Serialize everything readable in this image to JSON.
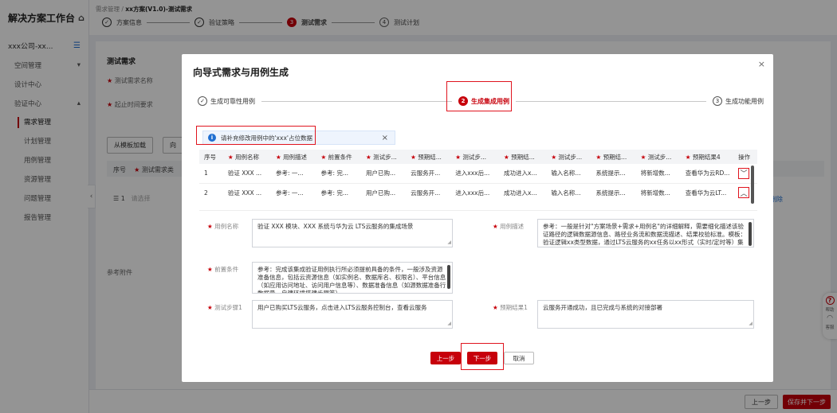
{
  "app": {
    "title": "解决方案工作台"
  },
  "sidebar": {
    "tenant": "xxx公司-xx...",
    "items": [
      {
        "label": "空间管理",
        "arrow": "▾"
      },
      {
        "label": "设计中心",
        "arrow": ""
      },
      {
        "label": "验证中心",
        "arrow": "▴"
      }
    ],
    "sub_items": [
      "需求管理",
      "计划管理",
      "用例管理",
      "资源管理",
      "问题管理",
      "报告管理"
    ]
  },
  "breadcrumb": {
    "parent": "需求管理 / ",
    "current": "xx方案(V1.0)-测试需求"
  },
  "page_steps": [
    {
      "label": "方案信息",
      "icon": "✓",
      "state": "done"
    },
    {
      "label": "验证策略",
      "icon": "✓",
      "state": "done"
    },
    {
      "label": "测试需求",
      "icon": "3",
      "state": "current"
    },
    {
      "label": "测试计划",
      "icon": "4",
      "state": "todo"
    }
  ],
  "background": {
    "section_title": "测试需求",
    "label_name": "测试需求名称",
    "label_time": "起止时间要求",
    "btn_template": "从模板加载",
    "btn_partial": "向",
    "col_no": "序号",
    "col_name": "测试需求类",
    "row_no": "1",
    "row_select": "请选择",
    "attach_label": "参考附件",
    "delete_link": "删除"
  },
  "footer": {
    "prev": "上一步",
    "save_next": "保存并下一步"
  },
  "float_help": {
    "help": "帮助",
    "service": "客服"
  },
  "modal": {
    "title": "向导式需求与用例生成",
    "close": "×",
    "wizard": [
      {
        "label": "生成可靠性用例",
        "icon": "✓",
        "state": "done"
      },
      {
        "label": "生成集成用例",
        "icon": "2",
        "state": "current"
      },
      {
        "label": "生成功能用例",
        "icon": "3",
        "state": "todo"
      }
    ],
    "alert": {
      "text": "请补充修改用例中的'xxx'占位数据",
      "close": "×"
    },
    "table": {
      "headers": [
        "序号",
        "用例名称",
        "用例描述",
        "前置条件",
        "测试步...",
        "预期结...",
        "测试步...",
        "预期结...",
        "测试步...",
        "预期结...",
        "测试步...",
        "预期结果4",
        "操作"
      ],
      "required": [
        false,
        true,
        true,
        true,
        true,
        true,
        true,
        true,
        true,
        true,
        true,
        true,
        false
      ],
      "rows": [
        {
          "cells": [
            "1",
            "验证 XXX ...",
            "参考: 一...",
            "参考: 完...",
            "用户已购...",
            "云服务开...",
            "进入xxx后...",
            "成功进入x...",
            "输入名称...",
            "系统提示...",
            "将新增数...",
            "查看华为云RD..."
          ],
          "op": "﹀"
        },
        {
          "cells": [
            "2",
            "验证 XXX ...",
            "参考: 一...",
            "参考: 完...",
            "用户已购...",
            "云服务开...",
            "进入xxx后...",
            "成功进入x...",
            "输入名称...",
            "系统提示...",
            "将新增数...",
            "查看华为云LT..."
          ],
          "op": "︿"
        }
      ]
    },
    "fields": {
      "name_label": "用例名称",
      "name_value": "验证 XXX 模块、XXX 系统与华为云 LTS云服务的集成场景",
      "desc_label": "用例描述",
      "desc_value": "参考：一般是针对\"方案场景+需求+用例名\"的详细解释，需要细化描述该验证路径的逻辑数据源信息、路径业务流和数据流描述、结果校验标准。模板：验证逻辑xx类型数据，通过LTS云服务的xx任务以xx形式（实时/定时等）集成至LTS云服务xx版本xx表，以供上",
      "pre_label": "前置条件",
      "pre_value": "参考：完成该集成验证用例执行所必须提前具备的条件，一般涉及资源准备信息，包括云资源信息（如实例名、数据库名、权限名）、平台信息（如应用访问地址、访问用户信息等）、数据准备信息（如源数据准备行数据量、自建环境搭建步骤等）",
      "step1_label": "测试步骤1",
      "step1_value": "用户已购买LTS云服务，点击进入LTS云服务控制台，查看云服务",
      "exp1_label": "预期结果1",
      "exp1_value": "云服务开通成功，且已完成与系统的对接部署"
    },
    "buttons": {
      "prev": "上一步",
      "next": "下一步",
      "cancel": "取消"
    }
  }
}
